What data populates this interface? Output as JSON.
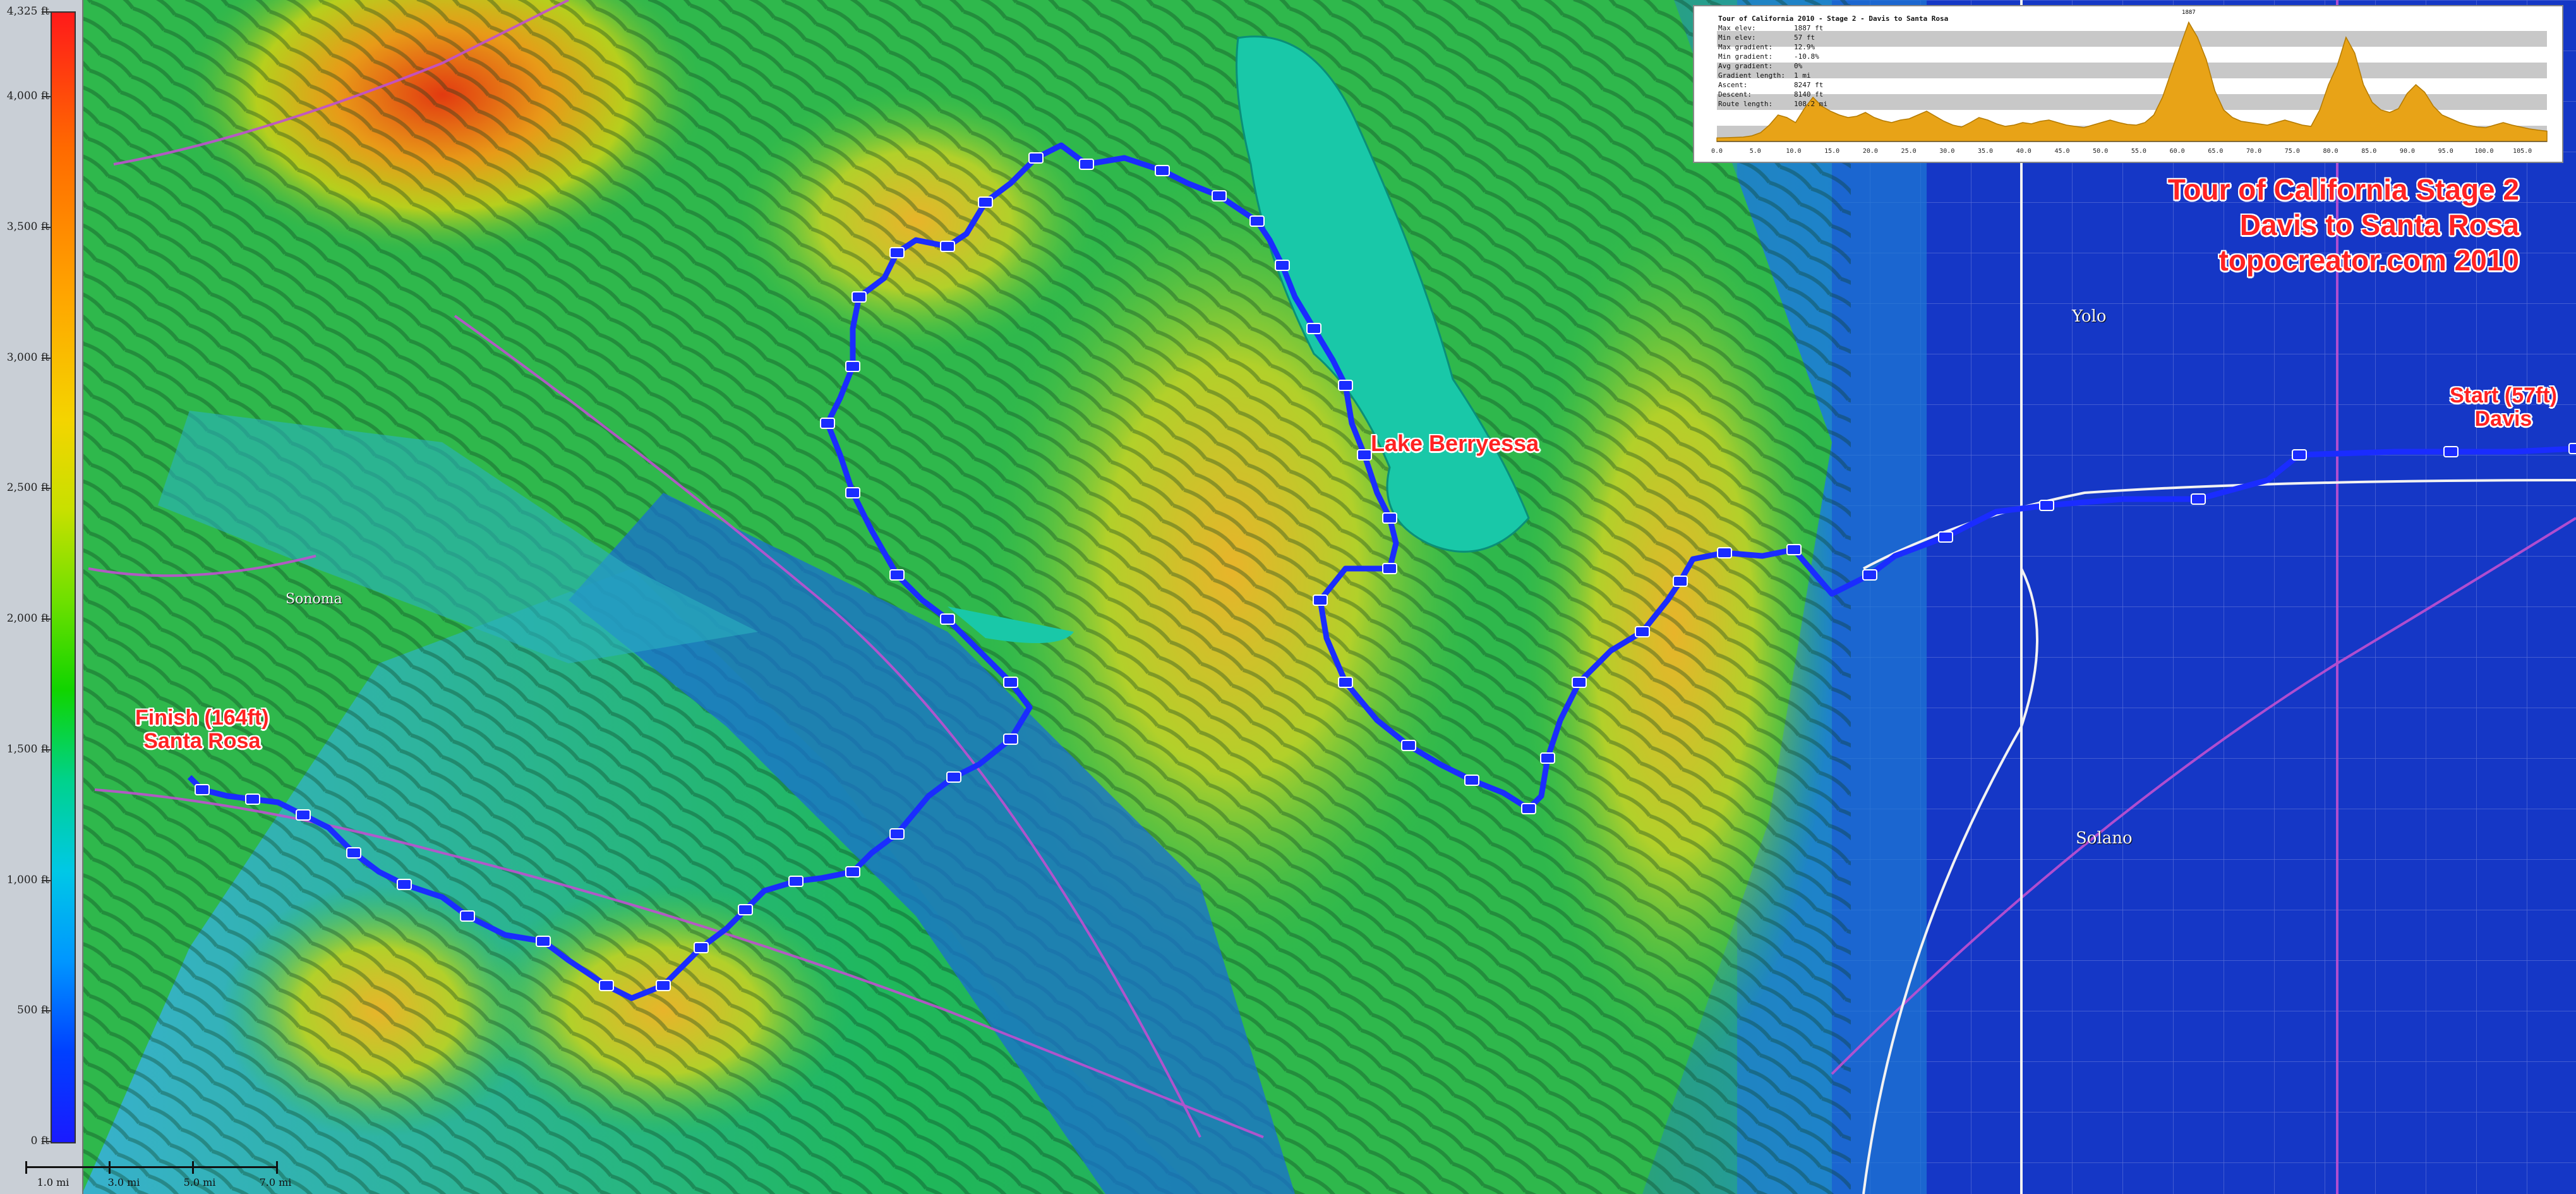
{
  "title": {
    "line1": "Tour of California Stage 2",
    "line2": "Davis to Santa Rosa",
    "line3": "topocreator.com 2010"
  },
  "labels": {
    "start": "Start (57ft)",
    "start_city": "Davis",
    "finish": "Finish (164ft)",
    "finish_city": "Santa Rosa",
    "lake": "Lake Berryessa"
  },
  "places": [
    {
      "name": "Yolo"
    },
    {
      "name": "Solano"
    },
    {
      "name": "Sonoma"
    }
  ],
  "elevation_legend": {
    "unit": "ft",
    "ticks": [
      "4,325 ft",
      "4,000 ft",
      "3,500 ft",
      "3,000 ft",
      "2,500 ft",
      "2,000 ft",
      "1,500 ft",
      "1,000 ft",
      "500 ft",
      "0 ft"
    ]
  },
  "scale_bar": {
    "labels": [
      "1.0 mi",
      "3.0 mi",
      "5.0 mi",
      "7.0 mi"
    ]
  },
  "profile": {
    "title": "Tour of California 2010 - Stage 2 - Davis to Santa Rosa",
    "stats": [
      {
        "key": "Max elev:",
        "value": "1887 ft"
      },
      {
        "key": "Min elev:",
        "value": "57 ft"
      },
      {
        "key": "Max gradient:",
        "value": "12.9%"
      },
      {
        "key": "Min gradient:",
        "value": "-10.8%"
      },
      {
        "key": "Avg gradient:",
        "value": "0%"
      },
      {
        "key": "Gradient length:",
        "value": "1 mi"
      },
      {
        "key": "Ascent:",
        "value": "8247 ft"
      },
      {
        "key": "Descent:",
        "value": "8140 ft"
      },
      {
        "key": "Route length:",
        "value": "108.2 mi"
      }
    ],
    "x_ticks": [
      "0.0",
      "5.0",
      "10.0",
      "15.0",
      "20.0",
      "25.0",
      "30.0",
      "35.0",
      "40.0",
      "45.0",
      "50.0",
      "55.0",
      "60.0",
      "65.0",
      "70.0",
      "75.0",
      "80.0",
      "85.0",
      "90.0",
      "95.0",
      "100.0",
      "105.0"
    ],
    "peak_label": "1887",
    "color_fill": "#e8a317",
    "color_stroke": "#b47a00",
    "elevations_ft": [
      57,
      60,
      65,
      70,
      90,
      140,
      260,
      420,
      380,
      300,
      520,
      700,
      560,
      480,
      420,
      380,
      400,
      460,
      380,
      330,
      300,
      340,
      360,
      420,
      480,
      400,
      320,
      260,
      230,
      300,
      380,
      340,
      280,
      240,
      260,
      300,
      280,
      320,
      340,
      300,
      260,
      240,
      220,
      260,
      300,
      340,
      300,
      270,
      260,
      300,
      420,
      700,
      1100,
      1500,
      1887,
      1650,
      1300,
      800,
      500,
      380,
      320,
      300,
      280,
      260,
      300,
      340,
      300,
      260,
      240,
      500,
      900,
      1200,
      1650,
      1400,
      900,
      620,
      500,
      460,
      520,
      760,
      900,
      780,
      560,
      420,
      360,
      300,
      260,
      230,
      220,
      260,
      300,
      260,
      230,
      200,
      180,
      164
    ]
  },
  "colors": {
    "route": "#1a2cff",
    "roads": "#c050d0",
    "title_red": "#ff2222"
  }
}
